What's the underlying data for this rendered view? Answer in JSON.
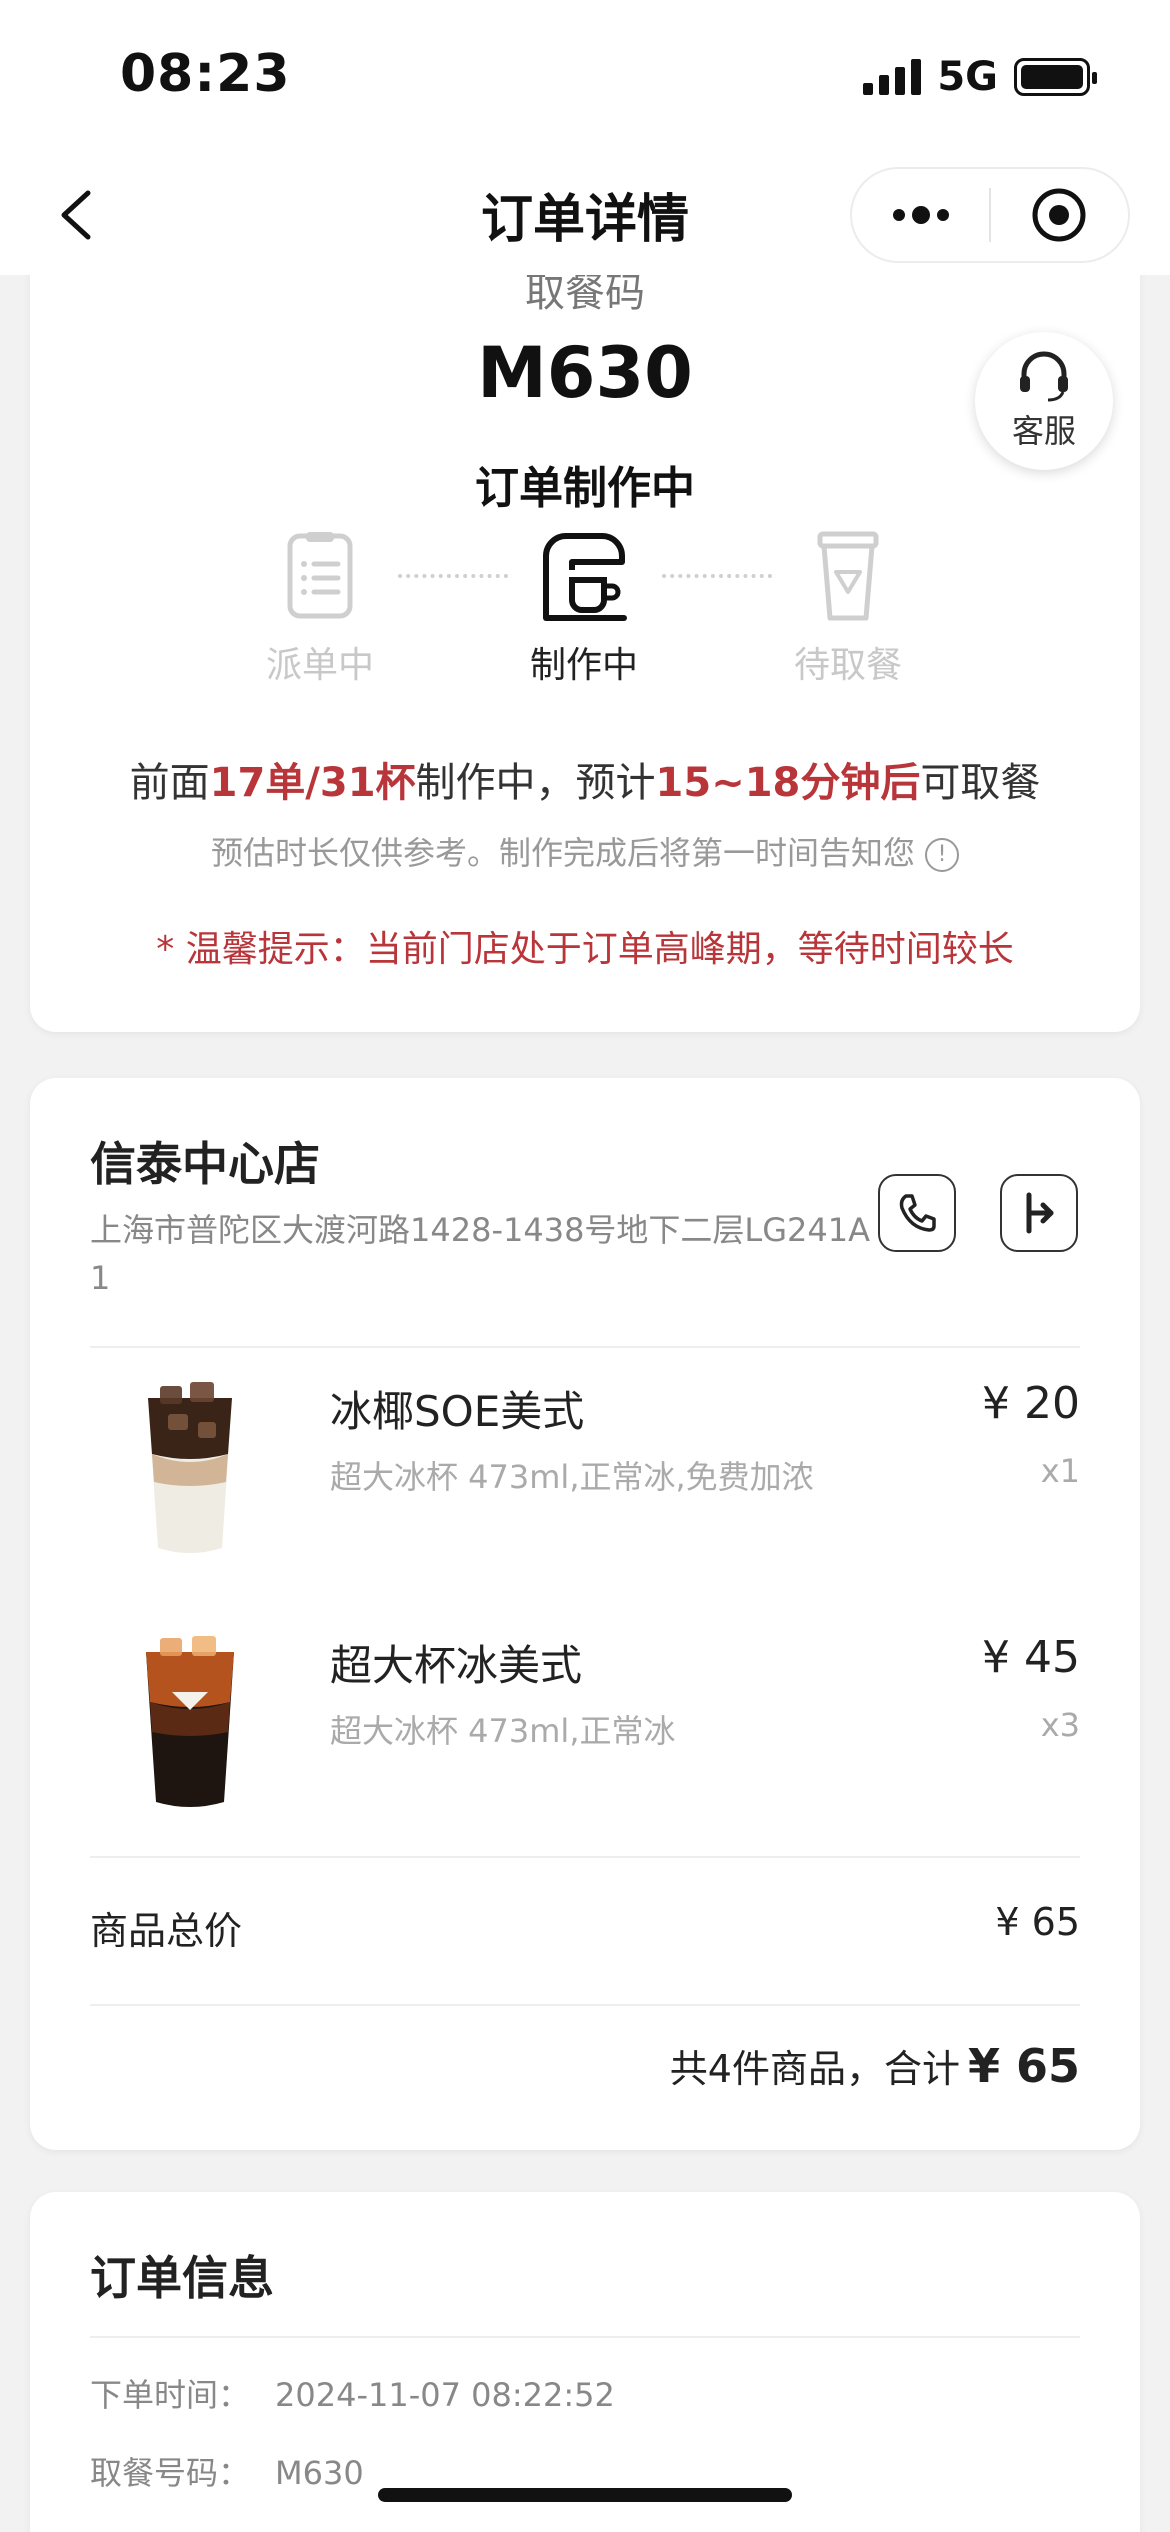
{
  "status_bar": {
    "time": "08:23",
    "network": "5G"
  },
  "nav": {
    "title": "订单详情"
  },
  "pickup": {
    "label": "取餐码",
    "code": "M630",
    "cs_label": "客服"
  },
  "order_status": "订单制作中",
  "steps": [
    {
      "label": "派单中",
      "state": "inactive",
      "icon": "list-icon"
    },
    {
      "label": "制作中",
      "state": "active",
      "icon": "coffee-machine-icon"
    },
    {
      "label": "待取餐",
      "state": "inactive",
      "icon": "cup-icon"
    }
  ],
  "queue": {
    "prefix": "前面",
    "count": "17单/31杯",
    "middle": "制作中，预计",
    "eta": "15~18分钟后",
    "suffix": "可取餐"
  },
  "estimate_note": "预估时长仅供参考。制作完成后将第一时间告知您",
  "warm_tip": "* 温馨提示：当前门店处于订单高峰期，等待时间较长",
  "store": {
    "name": "信泰中心店",
    "address": "上海市普陀区大渡河路1428-1438号地下二层LG241A1"
  },
  "items": [
    {
      "name": "冰椰SOE美式",
      "spec": "超大冰杯 473ml,正常冰,免费加浓",
      "price": "¥ 20",
      "qty": "x1"
    },
    {
      "name": "超大杯冰美式",
      "spec": "超大冰杯 473ml,正常冰",
      "price": "¥ 45",
      "qty": "x3"
    }
  ],
  "summary": {
    "subtotal_label": "商品总价",
    "subtotal_value": "¥ 65",
    "total_prefix": "共4件商品，合计",
    "total_amount": "¥ 65"
  },
  "order_info": {
    "title": "订单信息",
    "rows": [
      {
        "key": "下单时间：",
        "value": "2024-11-07 08:22:52"
      },
      {
        "key": "取餐号码：",
        "value": "M630"
      }
    ]
  },
  "colors": {
    "accent_red": "#b8353a",
    "background": "#f2f2f2"
  }
}
